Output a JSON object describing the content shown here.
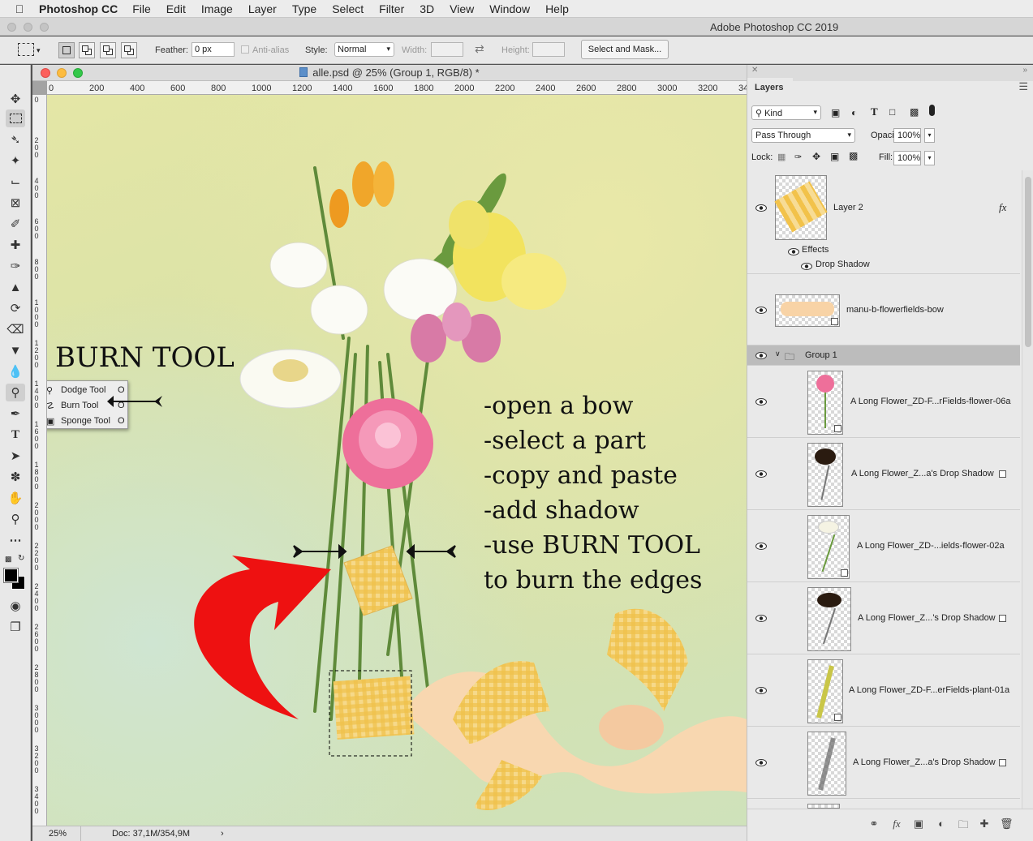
{
  "menubar": {
    "app": "Photoshop CC",
    "items": [
      "File",
      "Edit",
      "Image",
      "Layer",
      "Type",
      "Select",
      "Filter",
      "3D",
      "View",
      "Window",
      "Help"
    ]
  },
  "app_title": "Adobe Photoshop CC 2019",
  "options": {
    "feather_label": "Feather:",
    "feather_value": "0 px",
    "antialias_label": "Anti-alias",
    "style_label": "Style:",
    "style_value": "Normal",
    "width_label": "Width:",
    "height_label": "Height:",
    "select_mask": "Select and Mask..."
  },
  "document": {
    "title": "alle.psd @ 25% (Group 1, RGB/8) *",
    "zoom": "25%",
    "doc_info": "Doc: 37,1M/354,9M",
    "ruler_h": [
      "0",
      "200",
      "400",
      "600",
      "800",
      "1000",
      "1200",
      "1400",
      "1600",
      "1800",
      "2000",
      "2200",
      "2400",
      "2600",
      "2800",
      "3000",
      "3200",
      "34"
    ],
    "ruler_v": [
      "0",
      "200",
      "400",
      "600",
      "800",
      "1000",
      "1200",
      "1400",
      "1600",
      "1800",
      "2000",
      "2200",
      "2400",
      "2600",
      "2800",
      "3000",
      "3200",
      "3400"
    ]
  },
  "tool_flyout": {
    "items": [
      "Dodge Tool",
      "Burn Tool",
      "Sponge Tool"
    ],
    "shortcut": "O"
  },
  "annotations": {
    "heading": "BURN TOOL",
    "steps": [
      "-open a bow",
      "-select a part",
      "-copy and paste",
      "-add shadow",
      "-use BURN TOOL",
      "to burn the edges"
    ]
  },
  "layers_panel": {
    "tab": "Layers",
    "kind": "Kind",
    "blend": "Pass Through",
    "opacity_label": "Opacity:",
    "opacity": "100%",
    "lock_label": "Lock:",
    "fill_label": "Fill:",
    "fill": "100%",
    "layers": [
      {
        "name": "Layer 2",
        "fx": "fx",
        "effects": "Effects",
        "effect": "Drop Shadow"
      },
      {
        "name": "manu-b-flowerfields-bow"
      },
      {
        "name": "Group 1"
      },
      {
        "name": "A Long Flower_ZD-F...rFields-flower-06a"
      },
      {
        "name": "A Long Flower_Z...a's Drop Shadow"
      },
      {
        "name": "A Long Flower_ZD-...ields-flower-02a"
      },
      {
        "name": "A Long Flower_Z...'s Drop Shadow"
      },
      {
        "name": "A Long Flower_ZD-F...erFields-plant-01a"
      },
      {
        "name": "A Long Flower_Z...a's Drop Shadow"
      }
    ]
  }
}
